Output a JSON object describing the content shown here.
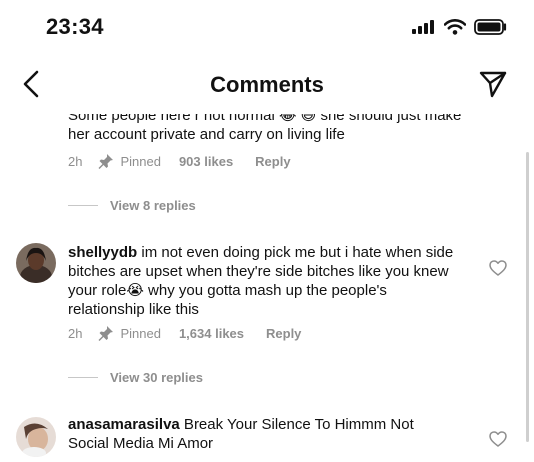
{
  "status": {
    "time": "23:34"
  },
  "header": {
    "title": "Comments"
  },
  "comments": [
    {
      "text_before": "Some people here r not normal 😂 ",
      "emoji": "😅",
      "text_after": " she should just make her account private and carry on living life",
      "time": "2h",
      "pinned_label": "Pinned",
      "likes": "903 likes",
      "reply": "Reply",
      "view_replies": "View 8 replies"
    },
    {
      "username": "shellyydb",
      "text_before": " im not even doing pick me but i hate when side bitches are upset when they're side bitches like you knew your role",
      "emoji": "😭",
      "text_after": " why you gotta mash up the people's relationship like this",
      "time": "2h",
      "pinned_label": "Pinned",
      "likes": "1,634 likes",
      "reply": "Reply",
      "view_replies": "View 30 replies"
    },
    {
      "username": "anasamarasilva",
      "text": " Break Your Silence To Himmm Not Social Media Mi Amor"
    }
  ],
  "icons": {
    "back": "chevron-left-icon",
    "send": "paper-plane-icon",
    "heart": "heart-outline-icon",
    "pin": "pin-icon"
  },
  "colors": {
    "meta_gray": "#8e8e8e",
    "divider": "#c7c7c7"
  }
}
